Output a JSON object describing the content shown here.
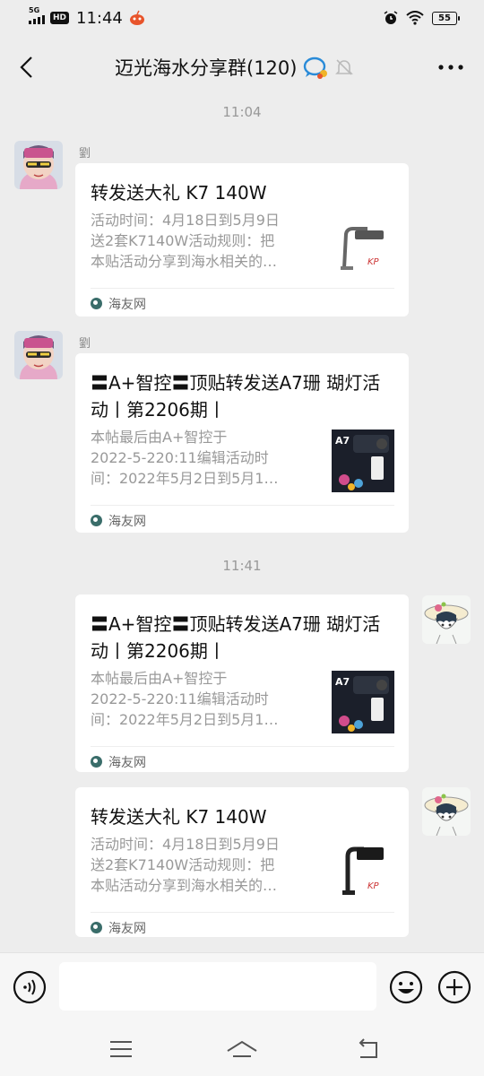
{
  "status_bar": {
    "network": "5G",
    "hd": "HD",
    "time": "11:44",
    "battery": "55"
  },
  "header": {
    "title": "迈光海水分享群(120)"
  },
  "messages": [
    {
      "time": "11:04",
      "sender": "劉",
      "title": "转发送大礼 K7 140W",
      "desc": [
        "活动时间：4月18日到5月9日",
        "送2套K7140W活动规则：把",
        "本贴活动分享到海水相关的…"
      ],
      "source": "海友网",
      "thumb_icon": "lamp-k7-thumbnail"
    },
    {
      "sender": "劉",
      "title": "〓A+智控〓顶贴转发送A7珊 瑚灯活动丨第2206期丨",
      "desc": [
        "本帖最后由A+智控于",
        "2022-5-220:11编辑活动时",
        "间：2022年5月2日到5月1…"
      ],
      "source": "海友网",
      "thumb_label": "A7"
    },
    {
      "time": "11:41",
      "title": "〓A+智控〓顶贴转发送A7珊 瑚灯活动丨第2206期丨",
      "desc": [
        "本帖最后由A+智控于",
        "2022-5-220:11编辑活动时",
        "间：2022年5月2日到5月1…"
      ],
      "source": "海友网",
      "thumb_label": "A7"
    },
    {
      "title": "转发送大礼 K7 140W",
      "desc": [
        "活动时间：4月18日到5月9日",
        "送2套K7140W活动规则：把",
        "本贴活动分享到海水相关的…"
      ],
      "source": "海友网"
    }
  ],
  "input": {
    "value": ""
  }
}
